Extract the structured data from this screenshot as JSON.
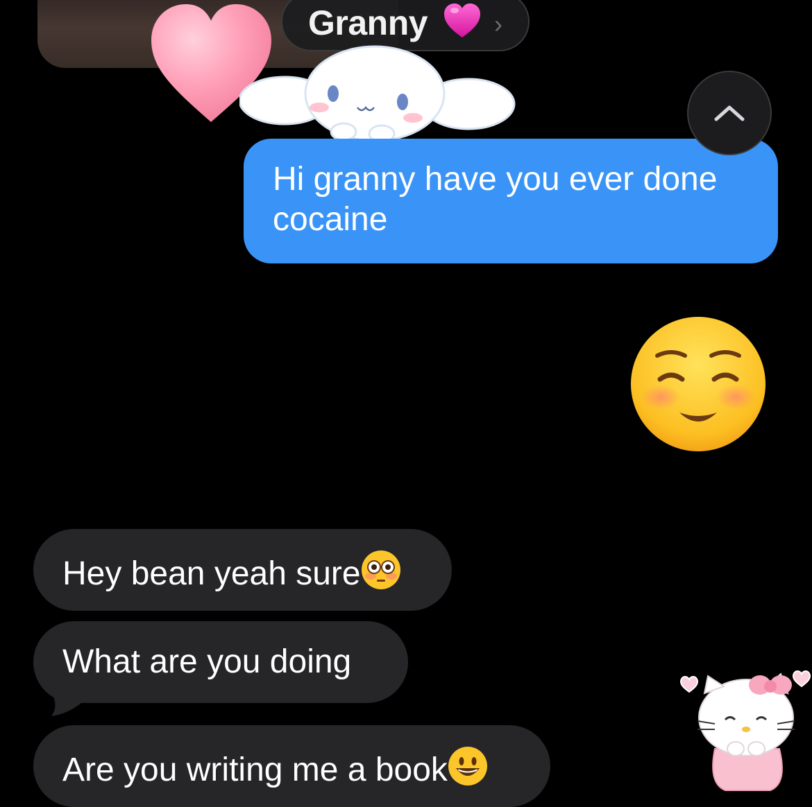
{
  "header": {
    "contact_name": "Granny",
    "contact_heart_icon": "pink-heart-icon",
    "chevron_icon": "chevron-right-icon"
  },
  "stickers": {
    "heart": "pink-heart-sticker",
    "top_character": "cinnamoroll-sticker",
    "bottom_character": "hello-kitty-sticker"
  },
  "scroll_up_icon": "chevron-up-icon",
  "messages": {
    "outgoing_1": "Hi granny have you ever done cocaine",
    "outgoing_emoji": "smiling-face-emoji",
    "incoming_1": "Hey bean yeah sure",
    "incoming_1_emoji": "flushed-face-emoji",
    "incoming_2": "What are you doing",
    "incoming_3": "Are you writing me a book",
    "incoming_3_emoji": "grinning-face-emoji"
  },
  "colors": {
    "background": "#000000",
    "outgoing_bubble": "#3a94f7",
    "incoming_bubble": "#262629",
    "text": "#ffffff"
  }
}
